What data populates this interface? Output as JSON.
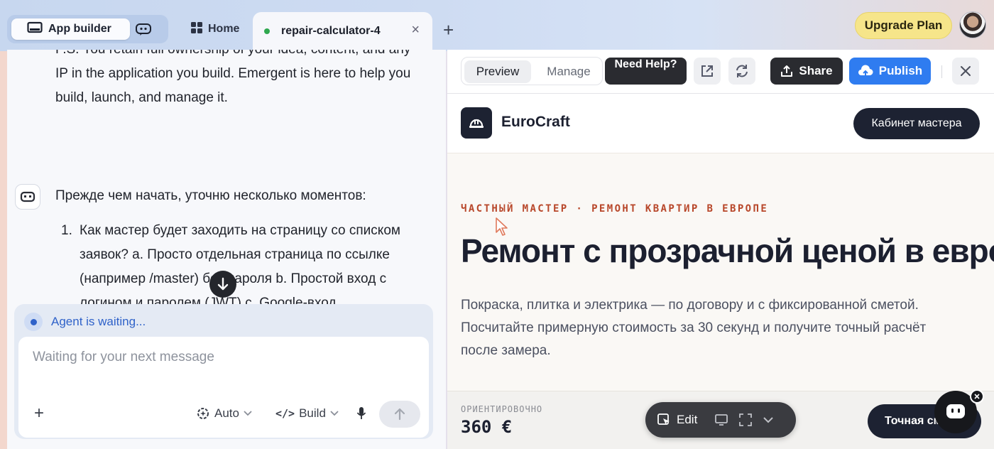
{
  "topbar": {
    "app_builder_label": "App builder",
    "home_tab_label": "Home",
    "active_tab_label": "repair-calculator-4",
    "tab_close": "×",
    "new_tab": "+",
    "upgrade_label": "Upgrade Plan"
  },
  "chat": {
    "previous_message": "P.S. You retain full ownership of your idea, content, and any IP in the application you build. Emergent is here to help you build, launch, and manage it.",
    "agent_intro": "Прежде чем начать, уточню несколько моментов:",
    "list_items": [
      {
        "number": "1.",
        "text": "Как мастер будет заходить на страницу со списком заявок? a. Просто отдельная страница по ссылке (например /master) без пароля b. Простой вход с логином и паролем (JWT) c. Google-вход"
      }
    ],
    "status": "Agent is waiting...",
    "input_placeholder": "Waiting for your next message",
    "add_label": "+",
    "mode_label": "Auto",
    "build_label": "Build"
  },
  "preview_toolbar": {
    "preview_tab": "Preview",
    "manage_tab": "Manage",
    "need_help": "Need Help?",
    "share_label": "Share",
    "publish_label": "Publish"
  },
  "site": {
    "brand": "EuroCraft",
    "cabinet_button": "Кабинет мастера",
    "eyebrow": "ЧАСТНЫЙ МАСТЕР · РЕМОНТ КВАРТИР В ЕВРОПЕ",
    "hero_title": "Ремонт с прозрачной ценой в евро",
    "lead": "Покраска, плитка и электрика — по договору и с фиксированной сметой. Посчитайте примерную стоимость за 30 секунд и получите точный расчёт после замера.",
    "approx_label": "ОРИЕНТИРОВОЧНО",
    "price": "360 €",
    "exact_button": "Точная смета"
  },
  "edit_bar": {
    "edit_label": "Edit"
  },
  "colors": {
    "accent_blue": "#2f7cf0",
    "dark": "#1d2232",
    "eyebrow": "#b8472a",
    "upgrade": "#f6e58a",
    "status_blue": "#2f62c9"
  }
}
